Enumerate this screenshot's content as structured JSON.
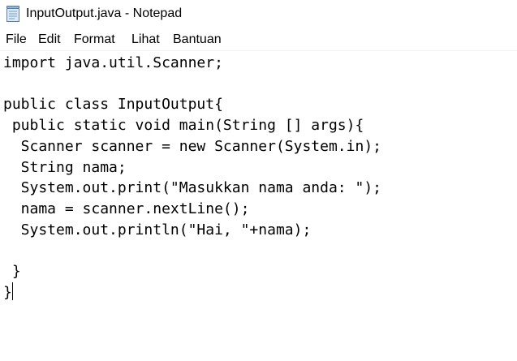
{
  "window": {
    "title": "InputOutput.java - Notepad",
    "icon": "notepad-icon"
  },
  "menu": {
    "items": [
      "File",
      "Edit",
      "Format",
      "Lihat",
      "Bantuan"
    ]
  },
  "editor": {
    "lines": [
      "import java.util.Scanner;",
      "",
      "public class InputOutput{",
      " public static void main(String [] args){",
      "  Scanner scanner = new Scanner(System.in);",
      "  String nama;",
      "  System.out.print(\"Masukkan nama anda: \");",
      "  nama = scanner.nextLine();",
      "  System.out.println(\"Hai, \"+nama);",
      "",
      " }",
      "}"
    ]
  }
}
